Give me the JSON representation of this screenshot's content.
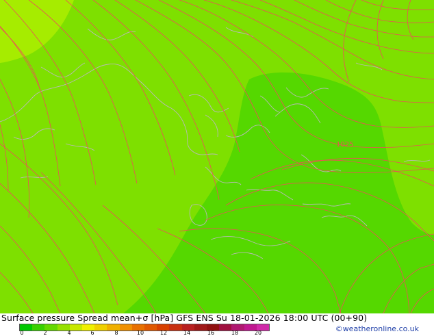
{
  "map": {
    "contour_label": "1025",
    "colors": {
      "base_green": "#7ee000",
      "light_green": "#a6ec00",
      "dark_green": "#55d800",
      "isobar": "#e85454",
      "coast": "#b9b9b9"
    }
  },
  "footer": {
    "title": "Surface pressure Spread mean+σ [hPa] GFS ENS  Su 18-01-2026 18:00 UTC (00+90)",
    "credit": "©weatheronline.co.uk",
    "scale_ticks": [
      "0",
      "2",
      "4",
      "6",
      "8",
      "10",
      "12",
      "14",
      "16",
      "18",
      "20"
    ],
    "scale_colors": [
      "#00c800",
      "#38d000",
      "#64d800",
      "#96e000",
      "#c8e800",
      "#f0f000",
      "#f0d000",
      "#f0b000",
      "#f09000",
      "#e87000",
      "#e05800",
      "#d84000",
      "#c83010",
      "#b82020",
      "#a01818",
      "#901010",
      "#a01040",
      "#b01870",
      "#c01890",
      "#d02aa8"
    ]
  }
}
